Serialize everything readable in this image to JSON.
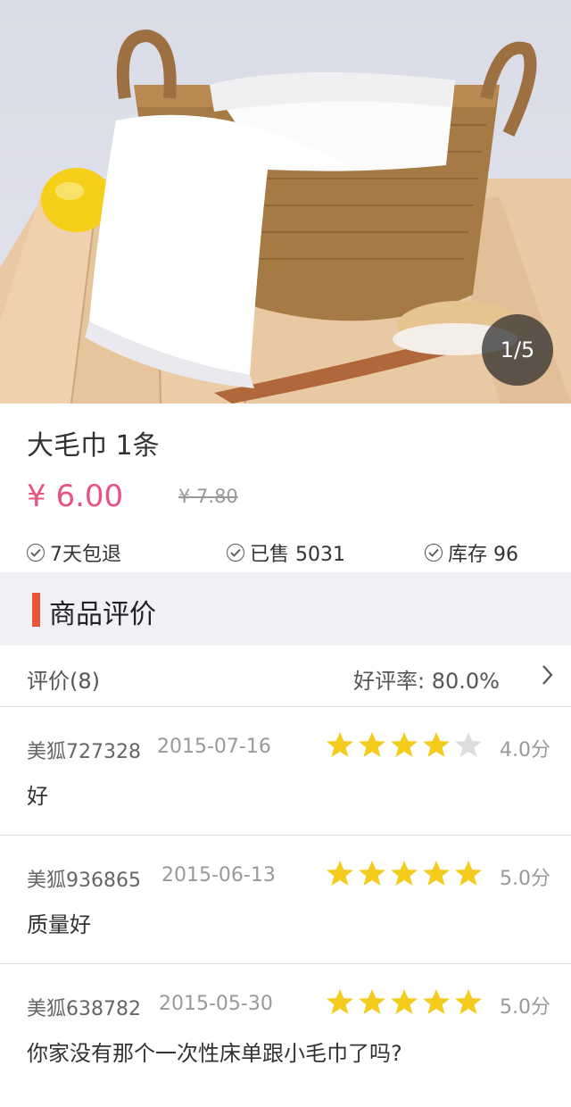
{
  "product": {
    "image_indicator": "1/5",
    "title": "大毛巾 1条",
    "price": "¥ 6.00",
    "original_price": "¥ 7.80",
    "guarantees": [
      "7天包退",
      "已售 5031",
      "库存 96"
    ]
  },
  "reviews_section": {
    "title": "商品评价",
    "count_label": "评价(8)",
    "rate_label": "好评率: 80.0%"
  },
  "reviews": [
    {
      "user": "美狐727328",
      "date": "2015-07-16",
      "rating": 4,
      "score": "4.0分",
      "comment": "好"
    },
    {
      "user": "美狐936865",
      "date": "2015-06-13",
      "rating": 5,
      "score": "5.0分",
      "comment": "质量好"
    },
    {
      "user": "美狐638782",
      "date": "2015-05-30",
      "rating": 5,
      "score": "5.0分",
      "comment": "你家没有那个一次性床单跟小毛巾了吗?"
    }
  ],
  "colors": {
    "price": "#e8537f",
    "accent_bar": "#e8533a",
    "star_filled": "#f5cb1c",
    "star_empty": "#dddddd"
  }
}
